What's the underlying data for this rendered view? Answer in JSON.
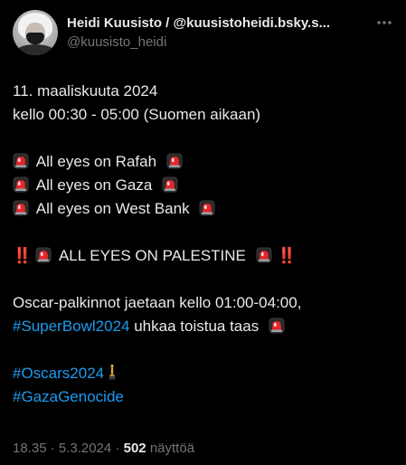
{
  "author": {
    "display_name": "Heidi Kuusisto / @kuusistoheidi.bsky.s...",
    "handle": "@kuusisto_heidi",
    "avatar_icon": "avatar-photo-masked-person"
  },
  "more_icon": "more-horizontal-icon",
  "tweet": {
    "line_date": "11. maaliskuuta 2024",
    "line_time": "kello 00:30 - 05:00 (Suomen aikaan)",
    "eyes_rafah": "All eyes on Rafah",
    "eyes_gaza": "All eyes on Gaza",
    "eyes_westbank": "All eyes on West Bank",
    "bangs": "‼️",
    "eyes_palestine": "ALL EYES ON PALESTINE",
    "oscar_text": "Oscar-palkinnot jaetaan kello 01:00-04:00,",
    "superbowl_tag": "#SuperBowl2024",
    "superbowl_rest": "uhkaa toistua taas",
    "oscars_tag": "#Oscars2024",
    "genocide_tag": "#GazaGenocide",
    "emoji": {
      "siren": "siren-icon",
      "oscar": "oscar-statuette-icon",
      "double_exclamation": "‼️"
    }
  },
  "meta": {
    "time": "18.35",
    "sep1": "·",
    "date": "5.3.2024",
    "sep2": "·",
    "views_count": "502",
    "views_label": "näyttöä"
  },
  "colors": {
    "background": "#000000",
    "text": "#e7e9ea",
    "secondary": "#71767b",
    "link": "#1d9bf0",
    "siren_red": "#e5262b"
  }
}
